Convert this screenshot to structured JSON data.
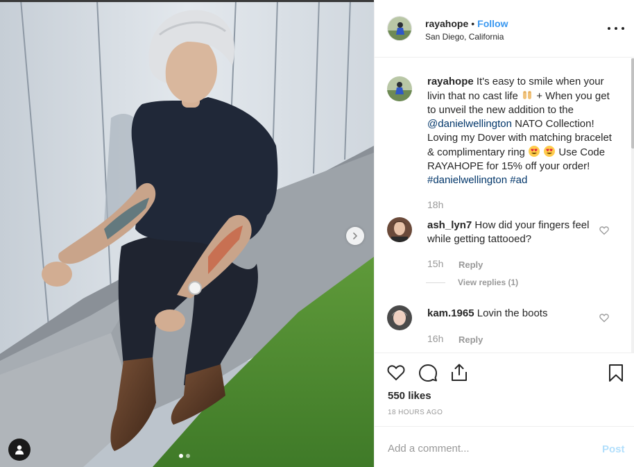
{
  "post": {
    "username": "rayahope",
    "separator": "•",
    "follow_label": "Follow",
    "location": "San Diego, California",
    "more_label": "More options"
  },
  "caption": {
    "username": "rayahope",
    "text_1": "It's easy to smile when your livin that no cast life",
    "text_2": "+ When you get to unveil the new addition to the",
    "mention": "@danielwellington",
    "text_3": "NATO Collection! Loving my Dover with matching bracelet & complimentary ring",
    "text_4": "Use Code RAYAHOPE for 15% off your order!",
    "hashtag_1": "#danielwellington",
    "hashtag_2": "#ad",
    "time": "18h"
  },
  "comments": [
    {
      "username": "ash_lyn7",
      "text": "How did your fingers feel while getting tattooed?",
      "time": "15h",
      "reply_label": "Reply",
      "view_replies": "View replies (1)"
    },
    {
      "username": "kam.1965",
      "text": "Lovin the boots",
      "time": "16h",
      "reply_label": "Reply"
    }
  ],
  "actions": {
    "icons": [
      "heart-icon",
      "comment-icon",
      "share-icon",
      "bookmark-icon"
    ],
    "likes": "550 likes",
    "posted": "18 HOURS AGO"
  },
  "add_comment": {
    "placeholder": "Add a comment...",
    "post_label": "Post"
  },
  "carousel": {
    "total": 2,
    "active": 1
  },
  "colors": {
    "accent": "#3897f0",
    "link": "#003569",
    "muted": "#999999",
    "post_disabled": "#b2dffc",
    "text": "#262626"
  }
}
